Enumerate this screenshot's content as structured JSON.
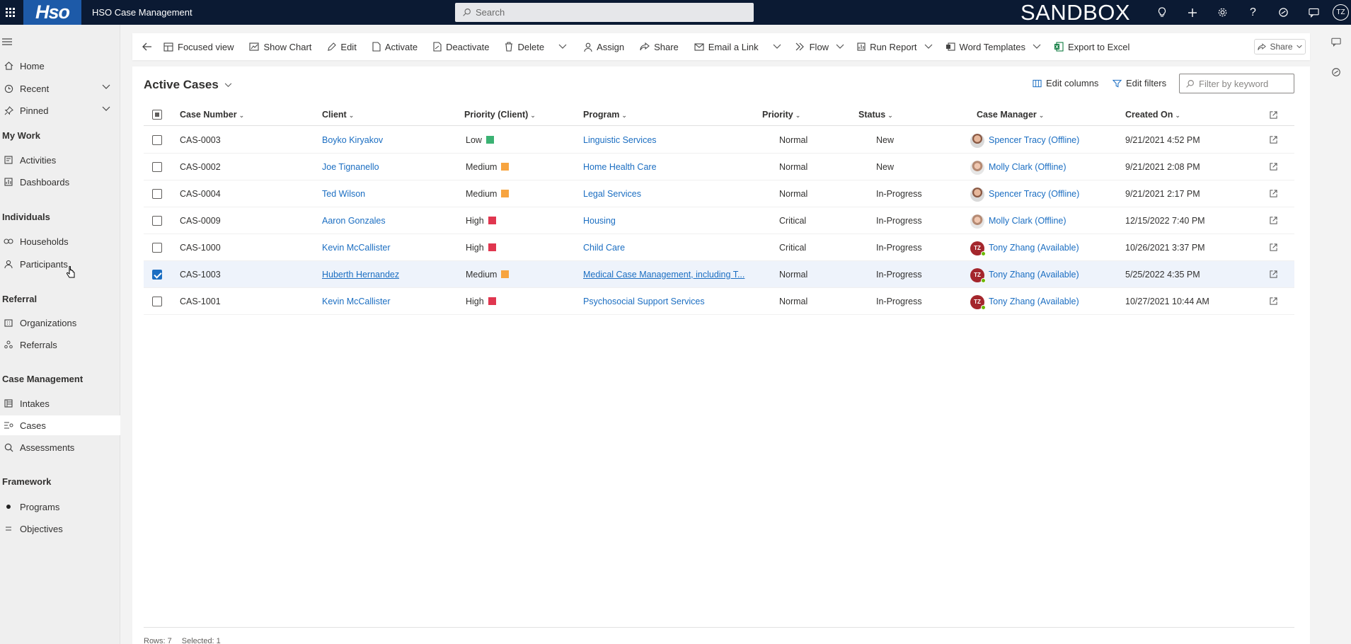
{
  "topbar": {
    "logo_text": "Hso",
    "app_title": "HSO Case Management",
    "search_placeholder": "Search",
    "environment": "SANDBOX",
    "user_initials": "TZ"
  },
  "nav": {
    "top_items": [
      {
        "label": "Home",
        "icon": "home-icon"
      },
      {
        "label": "Recent",
        "icon": "clock-icon"
      },
      {
        "label": "Pinned",
        "icon": "pin-icon"
      }
    ],
    "sections": [
      {
        "title": "My Work",
        "items": [
          {
            "label": "Activities"
          },
          {
            "label": "Dashboards"
          }
        ]
      },
      {
        "title": "Individuals",
        "items": [
          {
            "label": "Households"
          },
          {
            "label": "Participants"
          }
        ]
      },
      {
        "title": "Referral",
        "items": [
          {
            "label": "Organizations"
          },
          {
            "label": "Referrals"
          }
        ]
      },
      {
        "title": "Case Management",
        "items": [
          {
            "label": "Intakes"
          },
          {
            "label": "Cases"
          },
          {
            "label": "Assessments"
          }
        ]
      },
      {
        "title": "Framework",
        "items": [
          {
            "label": "Programs"
          },
          {
            "label": "Objectives"
          }
        ]
      }
    ]
  },
  "commands": {
    "focused_view": "Focused view",
    "show_chart": "Show Chart",
    "edit": "Edit",
    "activate": "Activate",
    "deactivate": "Deactivate",
    "delete": "Delete",
    "assign": "Assign",
    "share": "Share",
    "email_link": "Email a Link",
    "flow": "Flow",
    "run_report": "Run Report",
    "word_templates": "Word Templates",
    "export_excel": "Export to Excel",
    "share_top": "Share"
  },
  "view": {
    "title": "Active Cases",
    "edit_columns": "Edit columns",
    "edit_filters": "Edit filters",
    "filter_placeholder": "Filter by keyword"
  },
  "columns": [
    "Case Number",
    "Client",
    "Priority (Client)",
    "Program",
    "Priority",
    "Status",
    "Case Manager",
    "Created On"
  ],
  "priority_colors": {
    "Low": "#3bb273",
    "Medium": "#f7a440",
    "High": "#e0364f"
  },
  "rows": [
    {
      "case": "CAS-0003",
      "client": "Boyko Kiryakov",
      "pclient": "Low",
      "program": "Linguistic Services",
      "priority": "Normal",
      "status": "New",
      "manager": "Spencer Tracy (Offline)",
      "avatar": "photo",
      "created": "9/21/2021 4:52 PM",
      "selected": false
    },
    {
      "case": "CAS-0002",
      "client": "Joe Tignanello",
      "pclient": "Medium",
      "program": "Home Health Care",
      "priority": "Normal",
      "status": "New",
      "manager": "Molly Clark (Offline)",
      "avatar": "photo2",
      "created": "9/21/2021 2:08 PM",
      "selected": false
    },
    {
      "case": "CAS-0004",
      "client": "Ted Wilson",
      "pclient": "Medium",
      "program": "Legal Services",
      "priority": "Normal",
      "status": "In-Progress",
      "manager": "Spencer Tracy (Offline)",
      "avatar": "photo",
      "created": "9/21/2021 2:17 PM",
      "selected": false
    },
    {
      "case": "CAS-0009",
      "client": "Aaron Gonzales",
      "pclient": "High",
      "program": "Housing",
      "priority": "Critical",
      "status": "In-Progress",
      "manager": "Molly Clark (Offline)",
      "avatar": "photo2",
      "created": "12/15/2022 7:40 PM",
      "selected": false
    },
    {
      "case": "CAS-1000",
      "client": "Kevin McCallister",
      "pclient": "High",
      "program": "Child Care",
      "priority": "Critical",
      "status": "In-Progress",
      "manager": "Tony Zhang (Available)",
      "avatar": "tz",
      "created": "10/26/2021 3:37 PM",
      "selected": false
    },
    {
      "case": "CAS-1003",
      "client": "Huberth Hernandez",
      "pclient": "Medium",
      "program": "Medical Case Management, including T...",
      "priority": "Normal",
      "status": "In-Progress",
      "manager": "Tony Zhang (Available)",
      "avatar": "tz",
      "created": "5/25/2022 4:35 PM",
      "selected": true
    },
    {
      "case": "CAS-1001",
      "client": "Kevin McCallister",
      "pclient": "High",
      "program": "Psychosocial Support Services",
      "priority": "Normal",
      "status": "In-Progress",
      "manager": "Tony Zhang (Available)",
      "avatar": "tz",
      "created": "10/27/2021 10:44 AM",
      "selected": false
    }
  ],
  "footer": {
    "rows": "Rows: 7",
    "selected": "Selected: 1"
  }
}
